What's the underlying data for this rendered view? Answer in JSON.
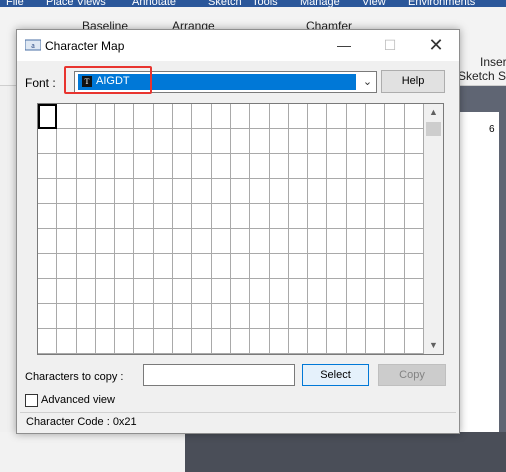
{
  "background_app": {
    "ribbon_tabs": [
      "File",
      "Place Views",
      "Annotate",
      "Sketch",
      "Tools",
      "Manage",
      "View",
      "Environments"
    ],
    "ribbon_buttons": [
      "Baseline",
      "Arrange",
      "Chamfer",
      "Insert",
      "Sketch Sy"
    ],
    "sheet_number": "6"
  },
  "dialog": {
    "title": "Character Map",
    "font_label": "Font :",
    "font_value": "AIGDT",
    "font_icon_glyph": "T",
    "help_label": "Help",
    "characters_to_copy_label": "Characters to copy :",
    "characters_to_copy_value": "",
    "select_label": "Select",
    "copy_label": "Copy",
    "advanced_view_label": "Advanced view",
    "advanced_view_checked": false,
    "status": "Character Code : 0x21",
    "grid": {
      "columns": 20,
      "rows": 10,
      "selected_index": 0
    }
  },
  "icons": {
    "minimize": "—",
    "maximize": "☐",
    "close": "✕",
    "dropdown": "⌄",
    "scroll_up": "▲",
    "scroll_down": "▼"
  },
  "colors": {
    "selection_blue": "#0078d7",
    "highlight_red": "#e8342f",
    "ribbon_blue": "#2b579a"
  }
}
